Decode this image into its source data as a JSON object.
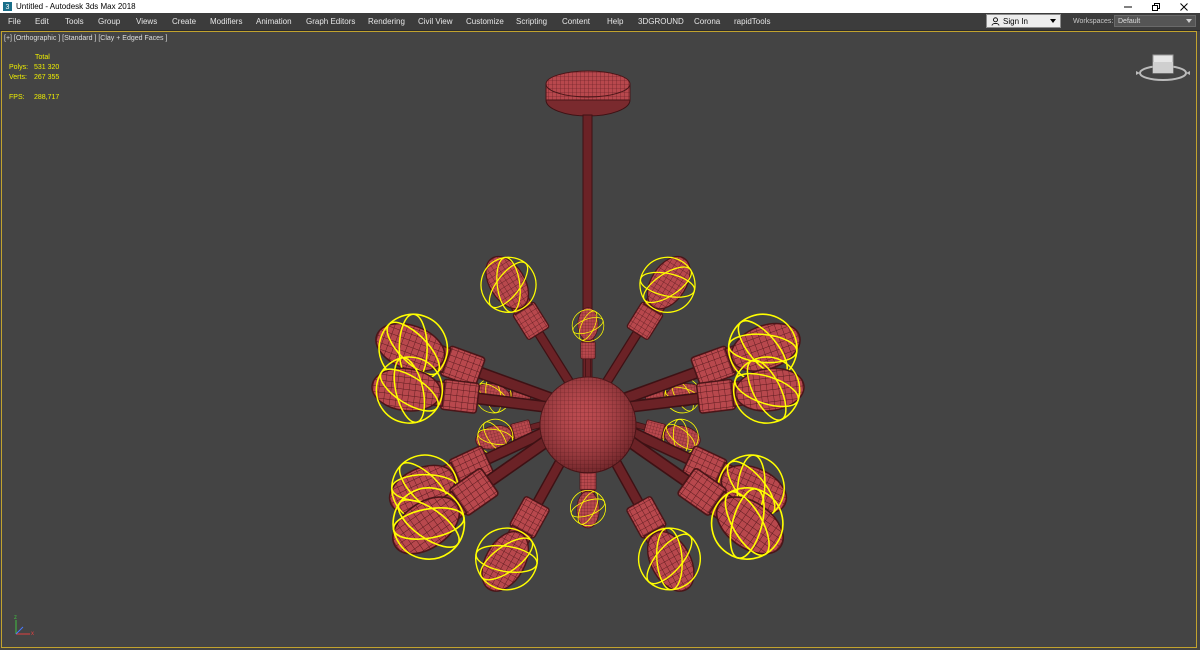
{
  "window": {
    "title": "Untitled - Autodesk 3ds Max 2018",
    "controls": [
      "minimize-icon",
      "restore-icon",
      "close-icon"
    ]
  },
  "menu": {
    "items": [
      "File",
      "Edit",
      "Tools",
      "Group",
      "Views",
      "Create",
      "Modifiers",
      "Animation",
      "Graph Editors",
      "Rendering",
      "Civil View",
      "Customize",
      "Scripting",
      "Content",
      "Help",
      "3DGROUND",
      "Corona",
      "rapidTools"
    ]
  },
  "account": {
    "sign_in": "Sign In",
    "workspaces_label": "Workspaces:",
    "workspace_value": "Default"
  },
  "viewport": {
    "label": "[+] [Orthographic ] [Standard ] [Clay + Edged Faces ]",
    "border_color": "#c2a32e",
    "background": "#444444"
  },
  "stats": {
    "header": "Total",
    "polys_label": "Polys:",
    "polys_value": "531 320",
    "verts_label": "Verts:",
    "verts_value": "267 355",
    "fps_label": "FPS:",
    "fps_value": "288,717",
    "color": "#f0f000"
  },
  "scene": {
    "object": "sputnik-chandelier",
    "mesh_color": "#b8484d",
    "wire_color": "#5a1a1e",
    "selection_color": "#ffff00",
    "bulb_count": 18
  }
}
